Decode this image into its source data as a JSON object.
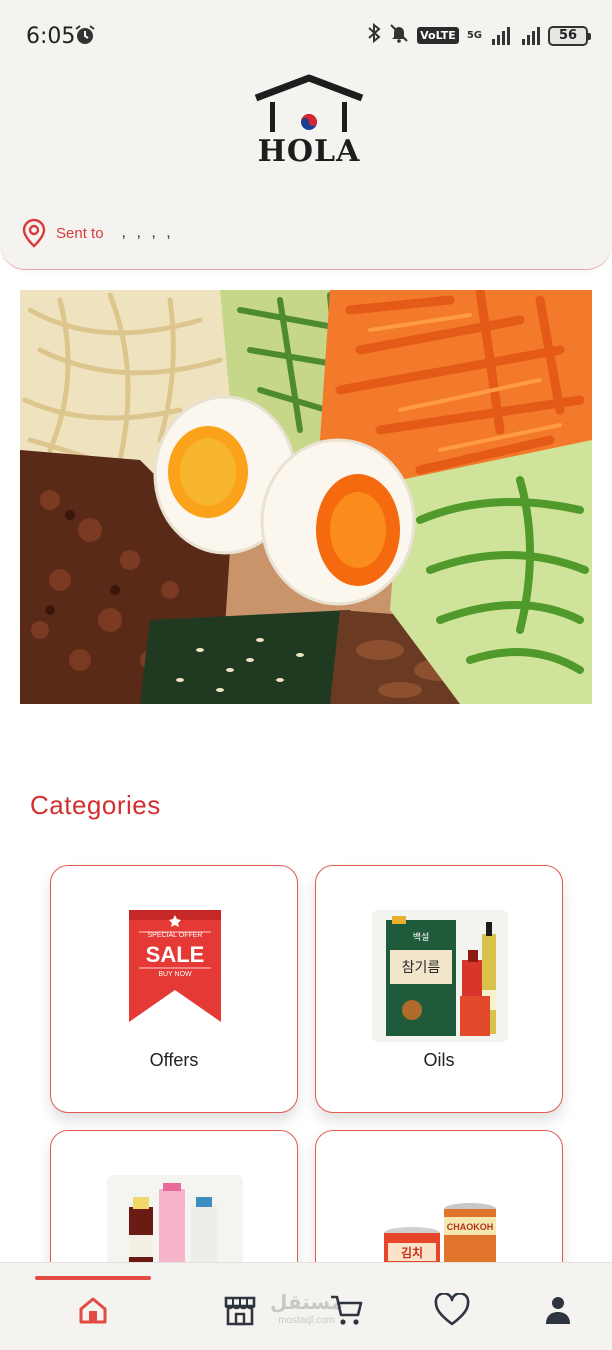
{
  "status": {
    "time": "6:05",
    "volte": "VoLTE",
    "network": "5G",
    "battery": "56"
  },
  "brand": {
    "name": "HOLA",
    "accent": "#d22f2f"
  },
  "location": {
    "label": "Sent to",
    "value": ", , , ,"
  },
  "categories": {
    "title": "Categories",
    "items": [
      {
        "label": "Offers",
        "image": "sale-ribbon"
      },
      {
        "label": "Oils",
        "image": "oil-bottles"
      },
      {
        "label": "",
        "image": "sauce-bottles"
      },
      {
        "label": "",
        "image": "canned-goods"
      }
    ]
  },
  "offer_badge": {
    "top": "SPECIAL OFFER",
    "main": "SALE",
    "bottom": "BUY NOW"
  },
  "oil_label": {
    "line1": "백설",
    "line2": "참기름"
  },
  "can_labels": {
    "brand": "CHAOKOH",
    "kimchi": "김치"
  },
  "nav": {
    "items": [
      "home-icon",
      "store-icon",
      "cart-icon",
      "heart-icon",
      "user-icon"
    ],
    "active": 0
  },
  "watermark": {
    "text": "مستقل",
    "sub": "mostaql.com"
  }
}
